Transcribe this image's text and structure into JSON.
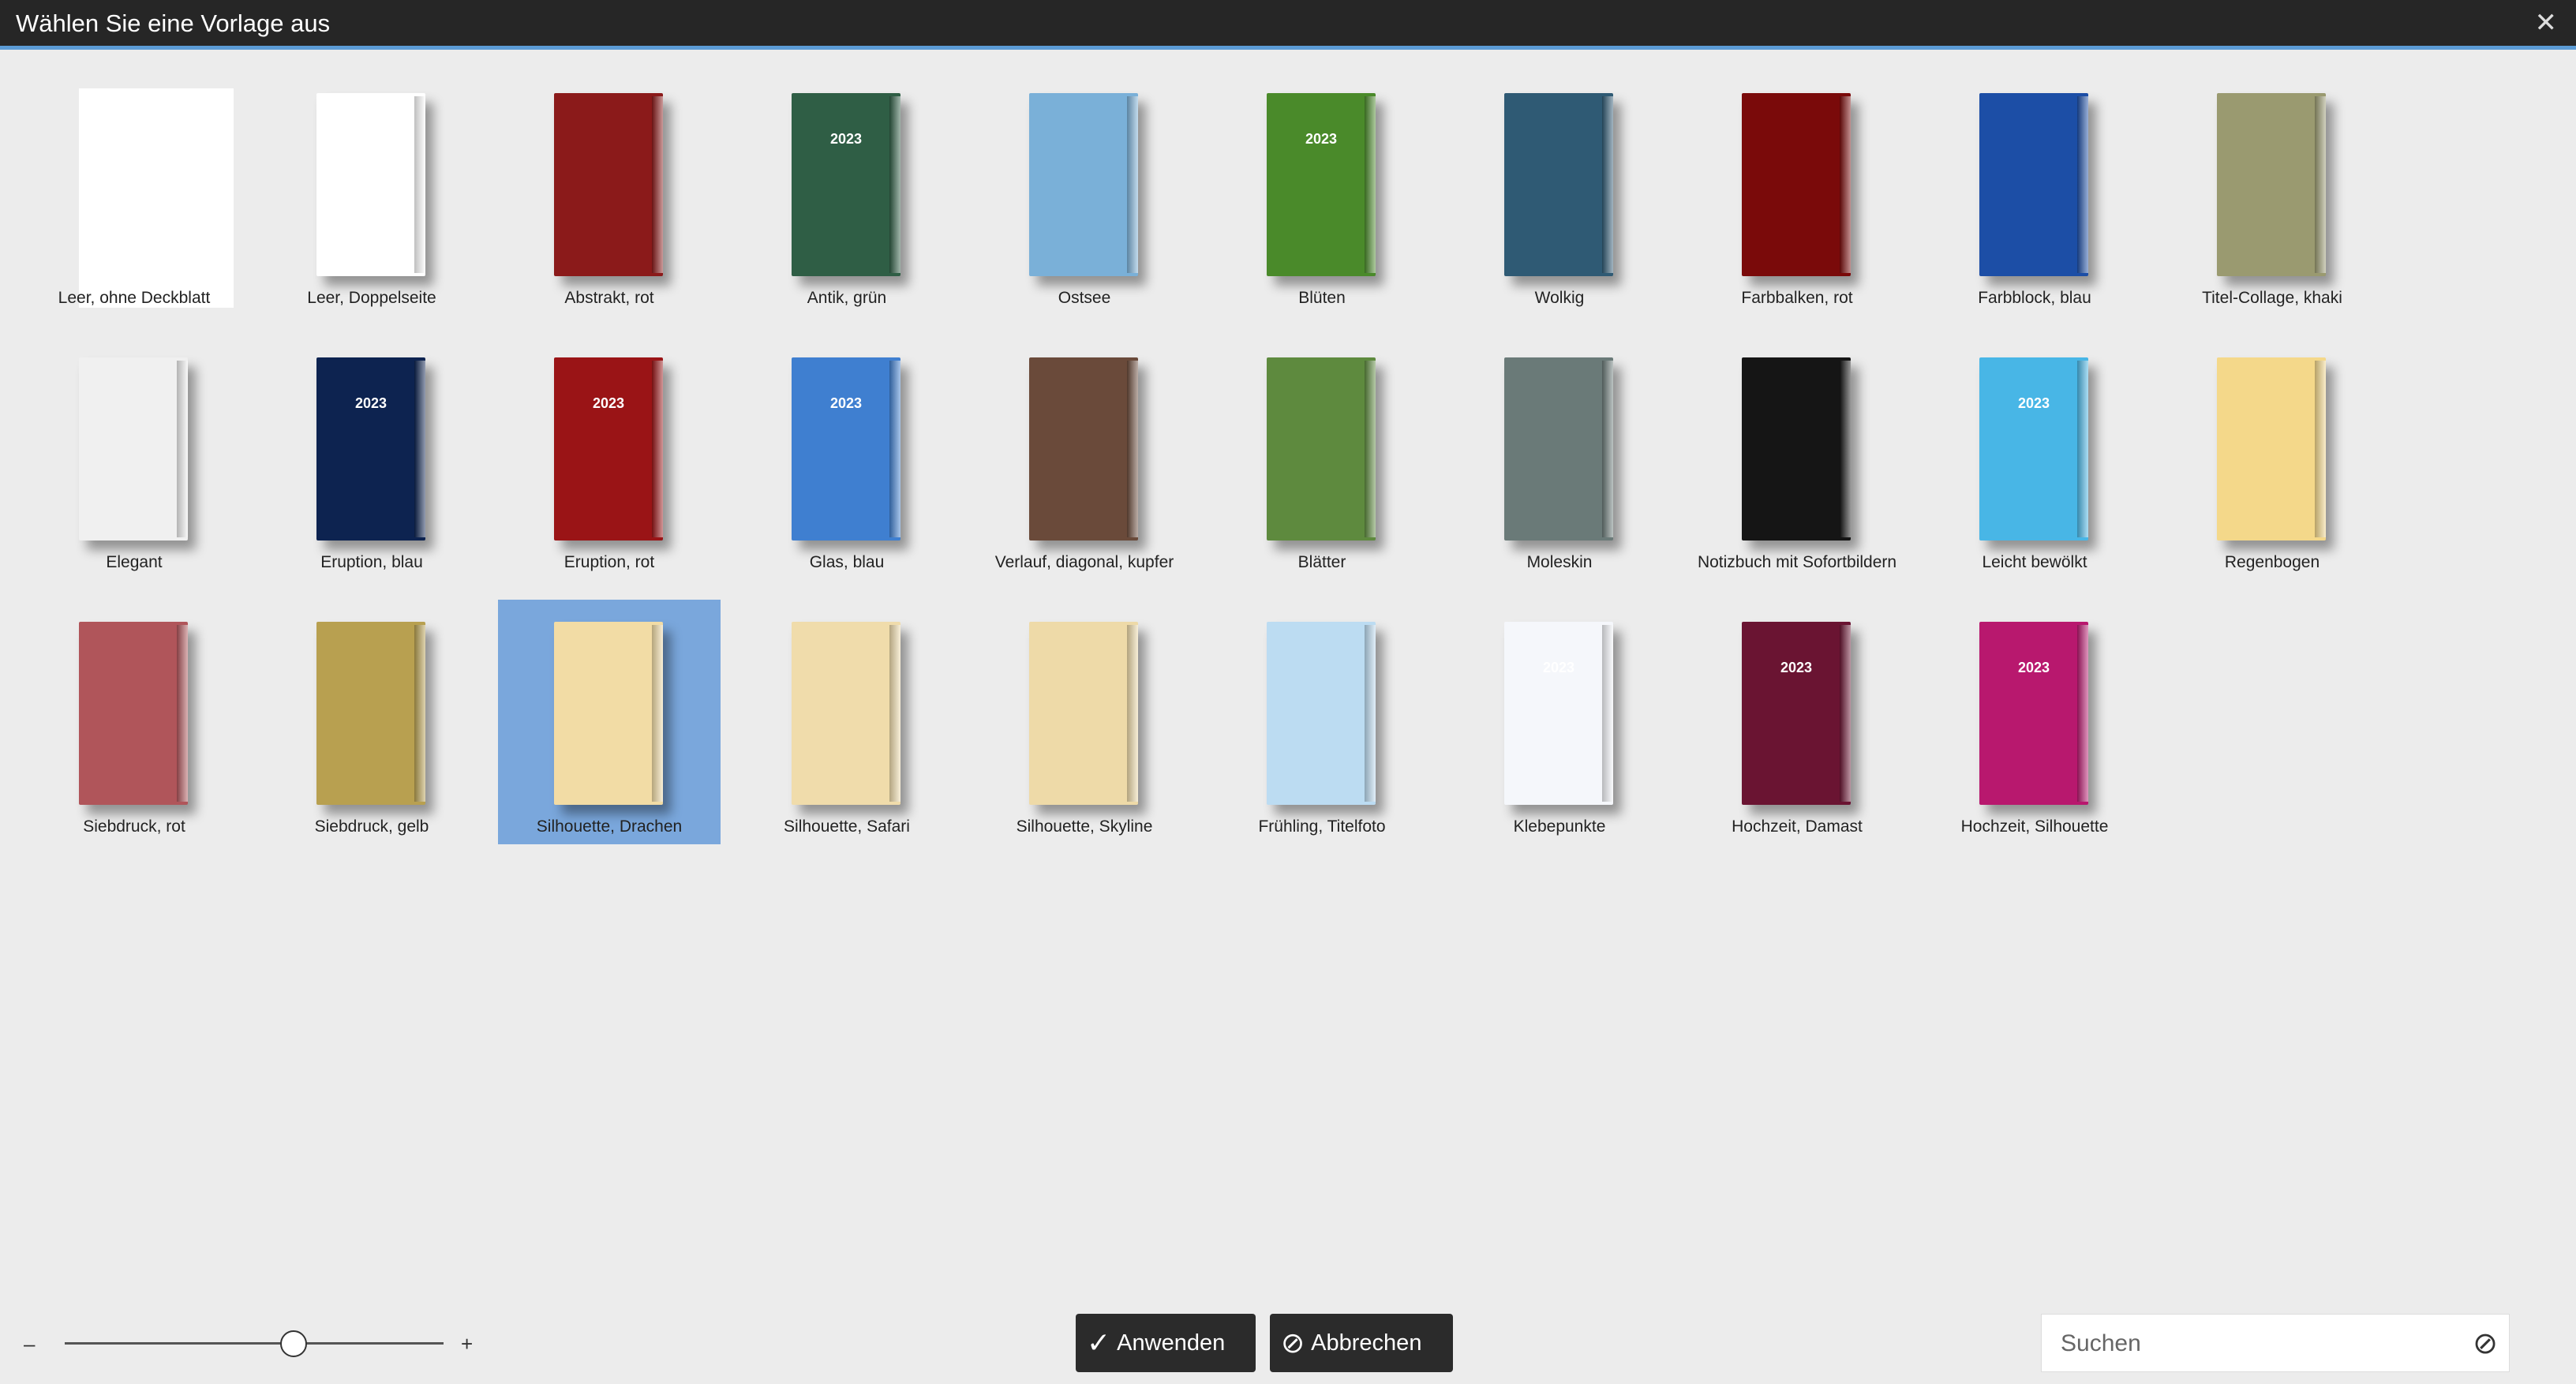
{
  "window": {
    "title": "Wählen Sie eine Vorlage aus",
    "close_icon": "close-icon"
  },
  "templates": [
    {
      "label": "Leer, ohne Deckblatt",
      "bg": "#ffffff",
      "style": "blank-flat"
    },
    {
      "label": "Leer, Doppelseite",
      "bg": "#ffffff"
    },
    {
      "label": "Abstrakt, rot",
      "bg": "#8b1a1a"
    },
    {
      "label": "Antik, grün",
      "bg": "#2f5e45",
      "text": "2023"
    },
    {
      "label": "Ostsee",
      "bg": "#7ab0d8"
    },
    {
      "label": "Blüten",
      "bg": "#4a8a2a",
      "text": "2023"
    },
    {
      "label": "Wolkig",
      "bg": "#2f5a74"
    },
    {
      "label": "Farbbalken, rot",
      "bg": "#7a0a0a"
    },
    {
      "label": "Farbblock, blau",
      "bg": "#1c4ea6"
    },
    {
      "label": "Titel-Collage, khaki",
      "bg": "#9a9a70"
    },
    {
      "label": "Elegant",
      "bg": "#f0f0f0"
    },
    {
      "label": "Eruption, blau",
      "bg": "#0d2350",
      "text": "2023"
    },
    {
      "label": "Eruption, rot",
      "bg": "#9a1416",
      "text": "2023"
    },
    {
      "label": "Glas, blau",
      "bg": "#3f7fd0",
      "text": "2023"
    },
    {
      "label": "Verlauf, diagonal, kupfer",
      "bg": "#6a4a3a"
    },
    {
      "label": "Blätter",
      "bg": "#5e8a3e"
    },
    {
      "label": "Moleskin",
      "bg": "#6a7a78"
    },
    {
      "label": "Notizbuch mit Sofortbildern",
      "bg": "#151515"
    },
    {
      "label": "Leicht bewölkt",
      "bg": "#48b6e6",
      "text": "2023"
    },
    {
      "label": "Regenbogen",
      "bg": "#f4d88a"
    },
    {
      "label": "Siebdruck, rot",
      "bg": "#b0555a"
    },
    {
      "label": "Siebdruck, gelb",
      "bg": "#b8a050"
    },
    {
      "label": "Silhouette, Drachen",
      "bg": "#f2dca5"
    },
    {
      "label": "Silhouette, Safari",
      "bg": "#f0dcab"
    },
    {
      "label": "Silhouette, Skyline",
      "bg": "#eedaa8"
    },
    {
      "label": "Frühling, Titelfoto",
      "bg": "#bcdcf2"
    },
    {
      "label": "Klebepunkte",
      "bg": "#f5f7fb",
      "text": "2023"
    },
    {
      "label": "Hochzeit, Damast",
      "bg": "#6a1432",
      "text": "2023"
    },
    {
      "label": "Hochzeit, Silhouette",
      "bg": "#b8186e",
      "text": "2023"
    }
  ],
  "selected_template": "Silhouette, Drachen",
  "zoom": {
    "minus": "–",
    "plus": "+",
    "level": 0.6
  },
  "buttons": {
    "apply": "Anwenden",
    "cancel": "Abbrechen"
  },
  "search": {
    "placeholder": "Suchen",
    "value": ""
  },
  "colors": {
    "titlebar": "#262626",
    "accent": "#5b9bd5",
    "selection": "#7aa7dc",
    "button": "#2b2b2b"
  }
}
